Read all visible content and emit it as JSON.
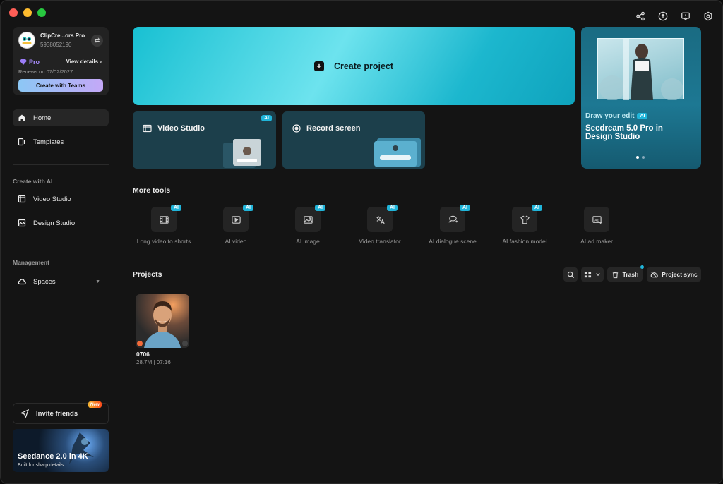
{
  "window": {
    "traffic_colors": [
      "#ff5f57",
      "#febc2e",
      "#28c840"
    ],
    "top_icons": [
      "share-icon",
      "upload-icon",
      "feedback-icon",
      "settings-icon"
    ]
  },
  "account": {
    "name": "ClipCre...ors Pro",
    "id": "5938052190",
    "plan": "Pro",
    "view_details": "View details",
    "renews": "Renews on 07/02/2027",
    "teams_button": "Create with Teams"
  },
  "nav": {
    "home": "Home",
    "templates": "Templates",
    "create_ai_label": "Create with AI",
    "video_studio": "Video Studio",
    "design_studio": "Design Studio",
    "management_label": "Management",
    "spaces": "Spaces"
  },
  "invite": {
    "label": "Invite friends",
    "badge": "New"
  },
  "promo": {
    "title": "Seedance 2.0 in 4K",
    "subtitle": "Built for sharp details"
  },
  "main": {
    "create_project": "Create project",
    "video_studio": "Video Studio",
    "record_screen": "Record screen",
    "ai_tag": "AI"
  },
  "hero": {
    "small": "Draw your edit",
    "title": "Seedream 5.0 Pro in Design Studio",
    "ai_tag": "AI"
  },
  "more_tools": {
    "title": "More tools",
    "items": [
      {
        "label": "Long video to shorts",
        "icon": "film-icon",
        "ai": "AI"
      },
      {
        "label": "AI video",
        "icon": "play-icon",
        "ai": "AI"
      },
      {
        "label": "AI image",
        "icon": "image-icon",
        "ai": "AI"
      },
      {
        "label": "Video translator",
        "icon": "translate-icon",
        "ai": "AI"
      },
      {
        "label": "AI dialogue scene",
        "icon": "dialogue-icon",
        "ai": "AI"
      },
      {
        "label": "AI fashion model",
        "icon": "shirt-icon",
        "ai": "AI"
      },
      {
        "label": "AI ad maker",
        "icon": "ad-icon",
        "ai": ""
      }
    ]
  },
  "projects": {
    "title": "Projects",
    "trash": "Trash",
    "sync": "Project sync",
    "items": [
      {
        "name": "0706",
        "meta": "28.7M | 07:16"
      }
    ]
  }
}
